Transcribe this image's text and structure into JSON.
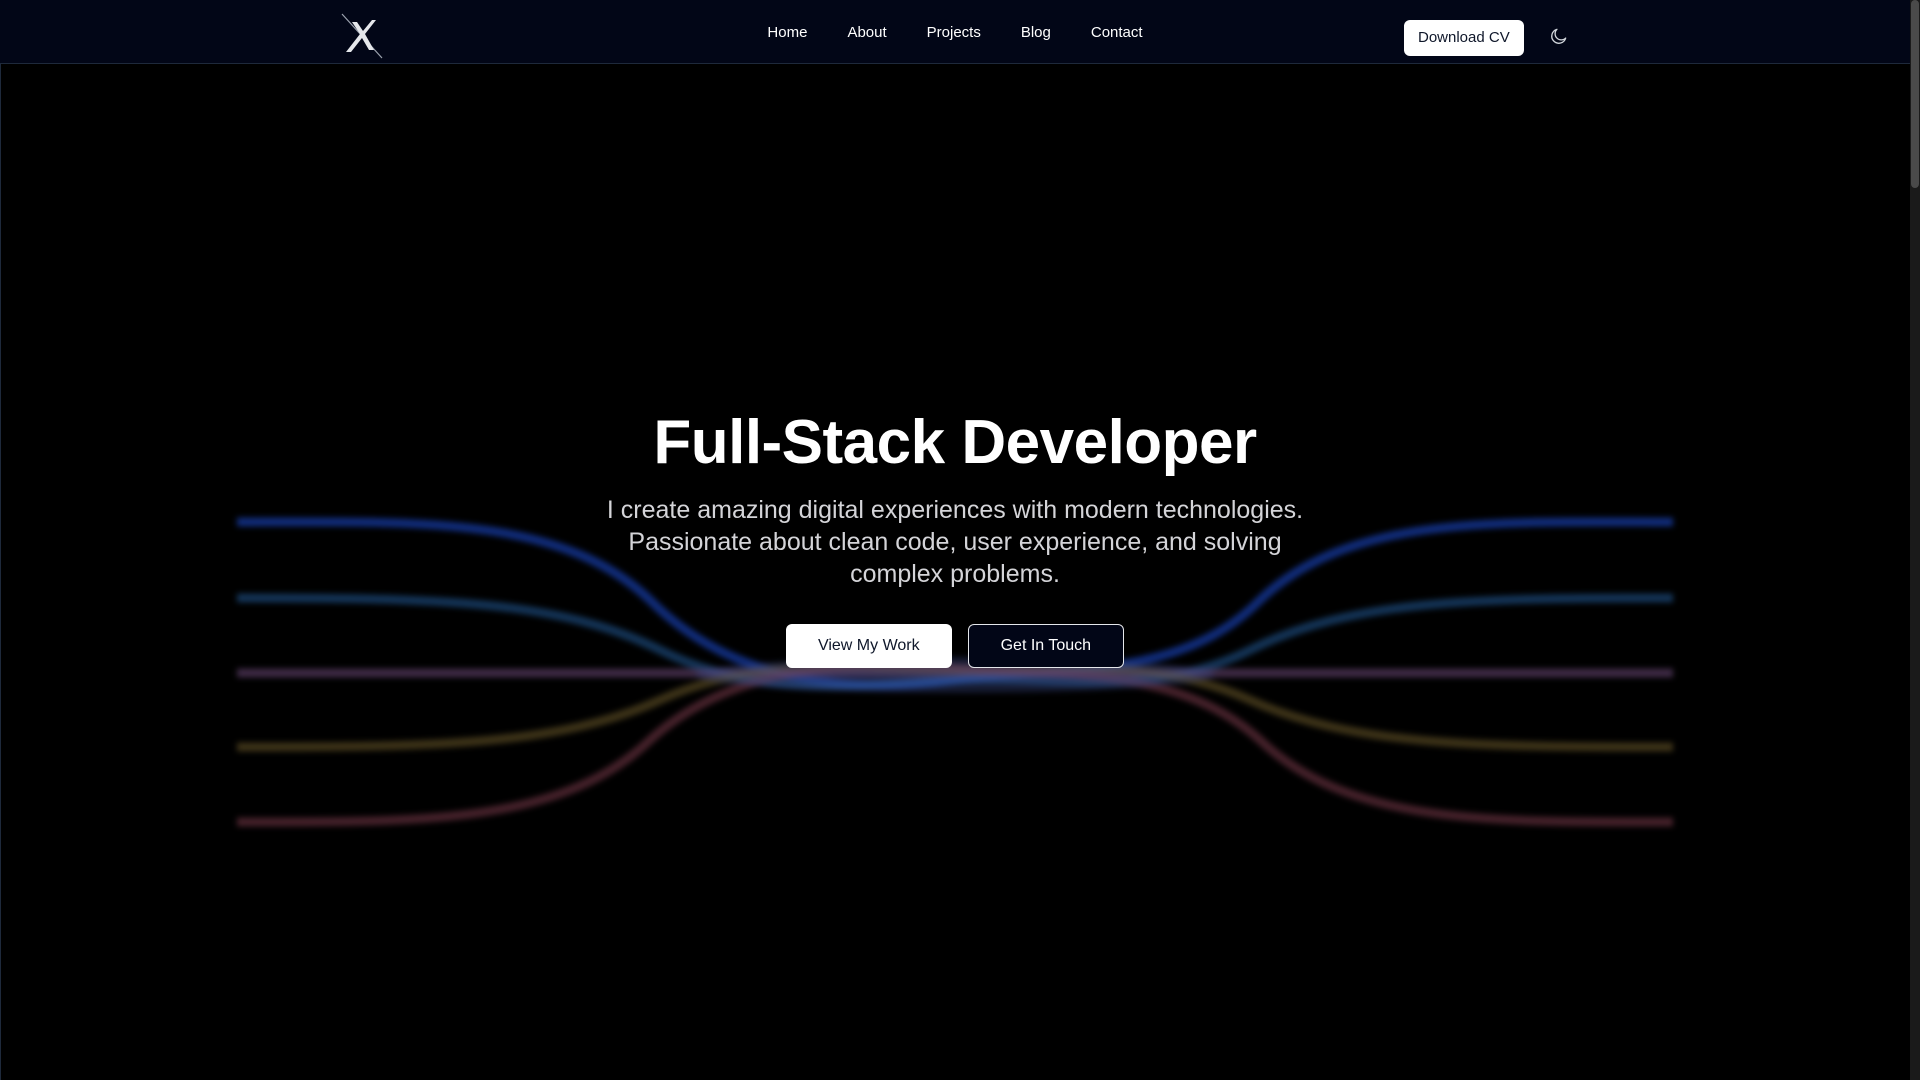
{
  "header": {
    "logo_icon": "x-logo-icon",
    "nav": [
      {
        "label": "Home"
      },
      {
        "label": "About"
      },
      {
        "label": "Projects"
      },
      {
        "label": "Blog"
      },
      {
        "label": "Contact"
      }
    ],
    "download_cv_label": "Download CV",
    "theme_toggle_icon": "moon-icon"
  },
  "hero": {
    "title": "Full-Stack Developer",
    "subtitle_lines": [
      "I create amazing digital experiences with modern technologies.",
      "Passionate about clean code, user experience, and solving",
      "complex problems."
    ],
    "primary_cta": "View My Work",
    "secondary_cta": "Get In Touch"
  },
  "colors": {
    "background": "#000000",
    "header_bg": "#020617",
    "wave_blue": "#1d4ed8",
    "wave_teal": "#2563a8",
    "wave_purple": "#6d4a7a",
    "wave_olive": "#6b5a2a",
    "wave_rose": "#7a3a4a"
  }
}
